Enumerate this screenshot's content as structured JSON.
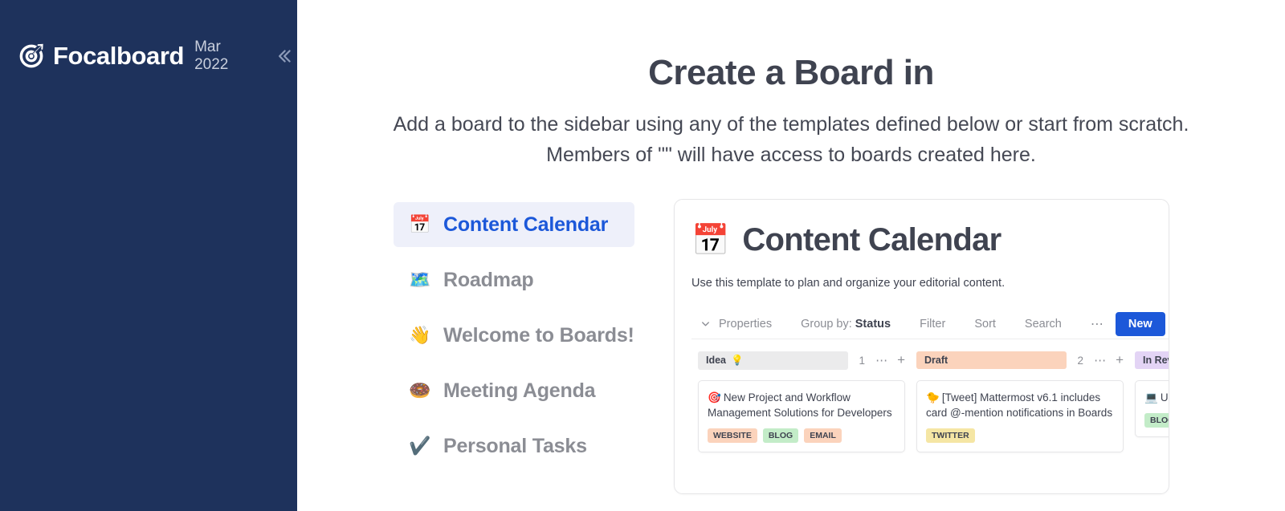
{
  "sidebar": {
    "logo_icon": "focalboard-target-icon",
    "brand": "Focalboard",
    "version": "Mar 2022",
    "collapse_icon": "double-chevron-left-icon",
    "background_color": "#1e325c"
  },
  "main": {
    "title": "Create a Board in",
    "description_line1": "Add a board to the sidebar using any of the templates defined below or start from scratch.",
    "description_line2": "Members of \"\" will have access to boards created here."
  },
  "templates": [
    {
      "emoji": "📅",
      "icon_name": "calendar-emoji-icon",
      "label": "Content Calendar",
      "selected": true
    },
    {
      "emoji": "🗺️",
      "icon_name": "map-emoji-icon",
      "label": "Roadmap",
      "selected": false
    },
    {
      "emoji": "👋",
      "icon_name": "waving-hand-emoji-icon",
      "label": "Welcome to Boards!",
      "selected": false
    },
    {
      "emoji": "🍩",
      "icon_name": "doughnut-emoji-icon",
      "label": "Meeting Agenda",
      "selected": false
    },
    {
      "emoji": "✔️",
      "icon_name": "check-mark-emoji-icon",
      "label": "Personal Tasks",
      "selected": false
    }
  ],
  "preview": {
    "board_emoji": "📅",
    "board_icon_name": "calendar-emoji-icon",
    "board_title": "Content Calendar",
    "board_description": "Use this template to plan and organize your editorial content.",
    "toolbar": {
      "chevron_icon": "chevron-down-icon",
      "properties": "Properties",
      "group_by_label": "Group by:",
      "group_by_value": "Status",
      "filter": "Filter",
      "sort": "Sort",
      "search": "Search",
      "more_icon": "ellipsis-icon",
      "new_button": "New"
    },
    "columns": [
      {
        "title": "Idea",
        "emoji": "💡",
        "emoji_name": "light-bulb-emoji-icon",
        "color": "#ebebec",
        "count": "1",
        "more_icon": "ellipsis-icon",
        "add_icon": "plus-icon",
        "cards": [
          {
            "emoji": "🎯",
            "emoji_name": "direct-hit-emoji-icon",
            "title": "New Project and Workflow Management Solutions for Developers",
            "tags": [
              {
                "label": "WEBSITE",
                "color": "#fbd3bc"
              },
              {
                "label": "BLOG",
                "color": "#c3ecc8"
              },
              {
                "label": "EMAIL",
                "color": "#fbd3bc"
              }
            ]
          }
        ]
      },
      {
        "title": "Draft",
        "emoji": "",
        "emoji_name": "",
        "color": "#fbd3bc",
        "count": "2",
        "more_icon": "ellipsis-icon",
        "add_icon": "plus-icon",
        "cards": [
          {
            "emoji": "🐤",
            "emoji_name": "baby-chick-emoji-icon",
            "title": "[Tweet] Mattermost v6.1 includes card @-mention notifications in Boards",
            "tags": [
              {
                "label": "TWITTER",
                "color": "#f5e6a4"
              }
            ]
          }
        ]
      },
      {
        "title": "In Review",
        "emoji": "",
        "emoji_name": "",
        "color": "#e3d4f5",
        "count": "",
        "more_icon": "",
        "add_icon": "",
        "cards": [
          {
            "emoji": "💻",
            "emoji_name": "laptop-emoji-icon",
            "title": "Unblocked Guide to Product",
            "tags": [
              {
                "label": "BLOG",
                "color": "#c3ecc8"
              }
            ]
          }
        ]
      }
    ]
  }
}
